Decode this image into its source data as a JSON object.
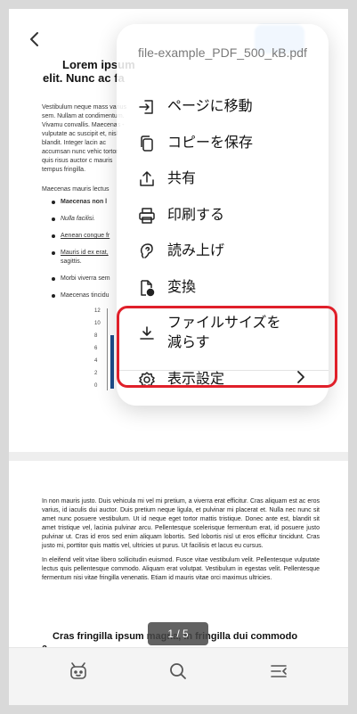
{
  "document": {
    "title_line1": "Lorem ipsum",
    "title_line2": "elit. Nunc ac fa",
    "para1": "Vestibulum neque mass varius sem. Nullam at condimentum. Vivamu convallis. Maecenas - vulputate ac suscipit et, nisl blandit. Integer lacin ac accumsan nunc vehic tortor quis risus auctor c mauris tempus fringilla.",
    "para2": "Maecenas mauris lectus",
    "bullets": [
      "Maecenas non l",
      "Nulla facilisi.",
      "Aenean congue fr",
      "Mauris id ex erat,",
      "sagittis.",
      "Morbi viverra sem",
      "Maecenas tincidu"
    ],
    "chart_ticks": [
      "12",
      "10",
      "8",
      "6",
      "4",
      "2",
      "0"
    ],
    "page2_para1": "In non mauris justo. Duis vehicula mi vel mi pretium, a viverra erat efficitur. Cras aliquam est ac eros varius, id iaculis dui auctor. Duis pretium neque ligula, et pulvinar mi placerat et. Nulla nec nunc sit amet nunc posuere vestibulum. Ut id neque eget tortor mattis tristique. Donec ante est, blandit sit amet tristique vel, lacinia pulvinar arcu. Pellentesque scelerisque fermentum erat, id posuere justo pulvinar ut. Cras id eros sed enim aliquam lobortis. Sed lobortis nisl ut eros efficitur tincidunt. Cras justo mi, porttitor quis mattis vel, ultricies ut purus. Ut facilisis et lacus eu cursus.",
    "page2_para2": "In eleifend velit vitae libero sollicitudin euismod. Fusce vitae vestibulum velit. Pellentesque vulputate lectus quis pellentesque commodo. Aliquam erat volutpat. Vestibulum in egestas velit. Pellentesque fermentum nisi vitae fringilla venenatis. Etiam id mauris vitae orci maximus ultricies.",
    "heading2_line1": "Cras fringilla ipsum magna, in fringilla dui commodo",
    "heading2_line2": "a."
  },
  "page_indicator": "1 / 5",
  "menu": {
    "file_name": "file-example_PDF_500_kB.pdf",
    "items": [
      {
        "label": "ページに移動",
        "icon": "go-to-page-icon"
      },
      {
        "label": "コピーを保存",
        "icon": "copy-icon"
      },
      {
        "label": "共有",
        "icon": "share-icon"
      },
      {
        "label": "印刷する",
        "icon": "print-icon"
      },
      {
        "label": "読み上げ",
        "icon": "read-aloud-icon"
      },
      {
        "label": "変換",
        "icon": "convert-icon"
      },
      {
        "label": "ファイルサイズを減らす",
        "icon": "download-icon"
      },
      {
        "label": "表示設定",
        "icon": "settings-icon"
      }
    ]
  },
  "colors": {
    "highlight": "#e0202a",
    "accent": "#5aa0ee"
  },
  "bottom_bar": [
    "robot-icon",
    "search-icon",
    "menu-collapse-icon"
  ]
}
